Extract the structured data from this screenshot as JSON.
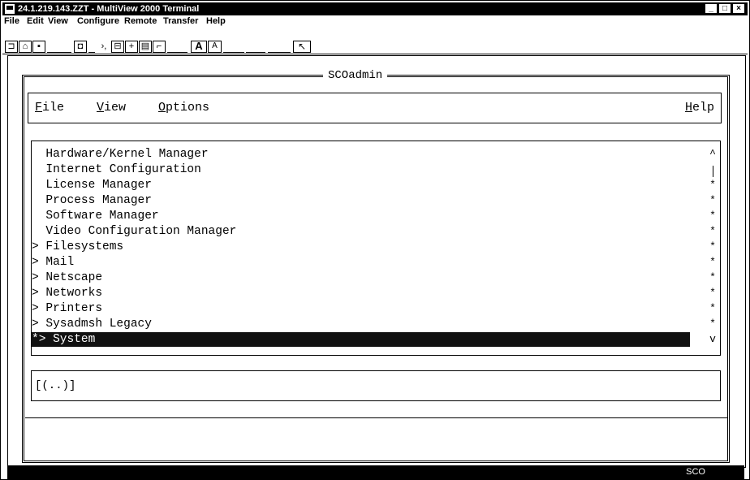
{
  "window": {
    "title": "24.1.219.143.ZZT - MultiView 2000 Terminal",
    "buttons": [
      "_",
      "□",
      "×"
    ]
  },
  "menubar": [
    "File",
    "Edit",
    "View",
    "Configure",
    "Remote",
    "Transfer",
    "Help"
  ],
  "toolbar": {
    "font_large": "A",
    "font_small": "A",
    "pointer": "↖"
  },
  "scoadmin": {
    "title": "SCOadmin",
    "menu": {
      "file": "File",
      "view": "View",
      "options": "Options",
      "help": "Help"
    },
    "list": [
      {
        "prefix": "  ",
        "label": "Hardware/Kernel Manager"
      },
      {
        "prefix": "  ",
        "label": "Internet Configuration"
      },
      {
        "prefix": "  ",
        "label": "License Manager"
      },
      {
        "prefix": "  ",
        "label": "Process Manager"
      },
      {
        "prefix": "  ",
        "label": "Software Manager"
      },
      {
        "prefix": "  ",
        "label": "Video Configuration Manager"
      },
      {
        "prefix": "> ",
        "label": "Filesystems"
      },
      {
        "prefix": "> ",
        "label": "Mail"
      },
      {
        "prefix": "> ",
        "label": "Netscape"
      },
      {
        "prefix": "> ",
        "label": "Networks"
      },
      {
        "prefix": "> ",
        "label": "Printers"
      },
      {
        "prefix": "> ",
        "label": "Sysadmsh Legacy"
      },
      {
        "prefix": "*> ",
        "label": "System",
        "selected": true
      }
    ],
    "scroll_up": "^",
    "scroll_down": "v",
    "scroll_marker": "*",
    "command_line": "[(..)]"
  },
  "status": {
    "text": "SCO"
  }
}
